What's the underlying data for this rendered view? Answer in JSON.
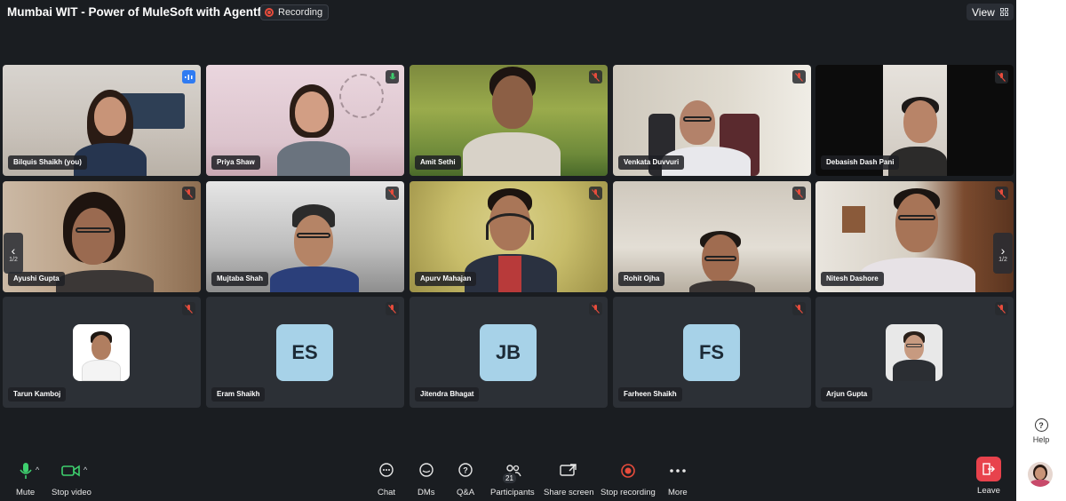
{
  "meeting": {
    "title": "Mumbai WIT - Power of MuleSoft with Agentforce",
    "recording_label": "Recording",
    "view_label": "View"
  },
  "participants": [
    {
      "name": "Bilquis Shaikh (you)",
      "mic": "speaking",
      "type": "video"
    },
    {
      "name": "Priya Shaw",
      "mic": "unmuted",
      "type": "video"
    },
    {
      "name": "Amit Sethi",
      "mic": "muted",
      "type": "video"
    },
    {
      "name": "Venkata Duvvuri",
      "mic": "muted",
      "type": "video"
    },
    {
      "name": "Debasish Dash Pani",
      "mic": "muted",
      "type": "video"
    },
    {
      "name": "Ayushi Gupta",
      "mic": "muted",
      "type": "video"
    },
    {
      "name": "Mujtaba Shah",
      "mic": "muted",
      "type": "video"
    },
    {
      "name": "Apurv Mahajan",
      "mic": "muted",
      "type": "video"
    },
    {
      "name": "Rohit Ojha",
      "mic": "muted",
      "type": "video"
    },
    {
      "name": "Nitesh Dashore",
      "mic": "muted",
      "type": "video"
    },
    {
      "name": "Tarun Kamboj",
      "mic": "muted",
      "type": "photo"
    },
    {
      "name": "Eram Shaikh",
      "mic": "muted",
      "type": "initials",
      "initials": "ES"
    },
    {
      "name": "Jitendra Bhagat",
      "mic": "muted",
      "type": "initials",
      "initials": "JB"
    },
    {
      "name": "Farheen Shaikh",
      "mic": "muted",
      "type": "initials",
      "initials": "FS"
    },
    {
      "name": "Arjun Gupta",
      "mic": "muted",
      "type": "photo"
    }
  ],
  "pagination": {
    "left": "1/2",
    "right": "1/2"
  },
  "toolbar": {
    "mute": "Mute",
    "stop_video": "Stop video",
    "chat": "Chat",
    "dms": "DMs",
    "qa": "Q&A",
    "participants": "Participants",
    "participants_count": "21",
    "share_screen": "Share screen",
    "stop_recording": "Stop recording",
    "more": "More",
    "leave": "Leave"
  },
  "sidebar": {
    "help": "Help"
  },
  "colors": {
    "background": "#1a1d21",
    "recording_red": "#e74c3c",
    "mic_green": "#3ecf6e",
    "leave_red": "#e8424c",
    "speaking_blue": "#2f7bf2",
    "initials_bg": "#a7d2e8"
  }
}
